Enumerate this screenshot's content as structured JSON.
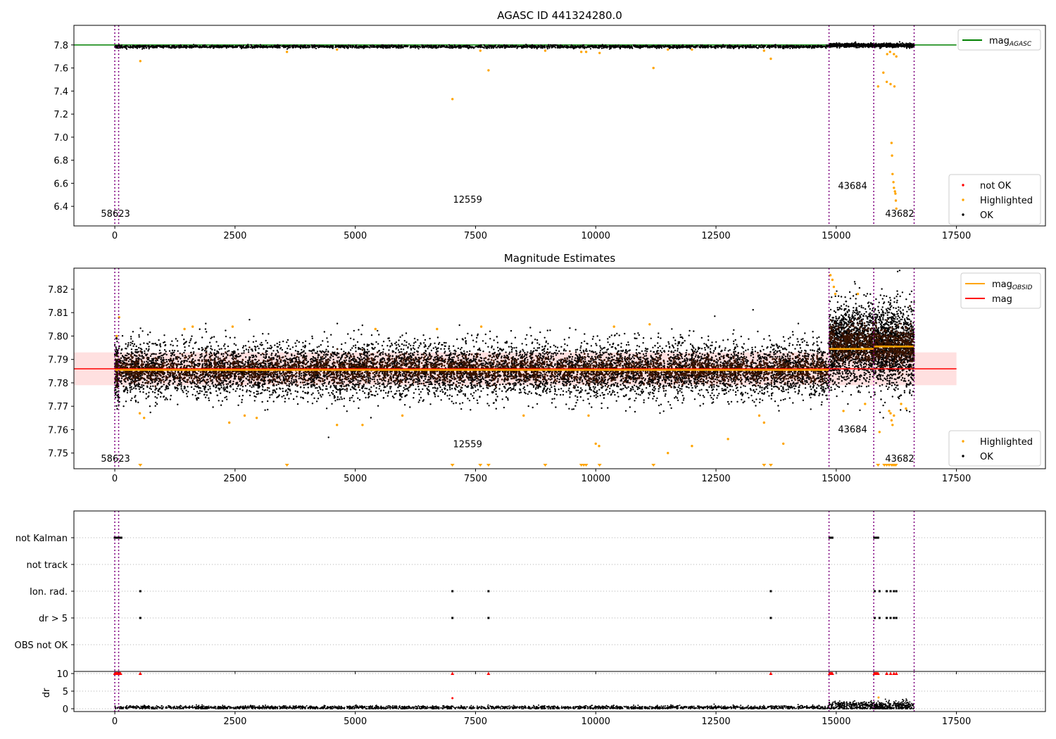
{
  "figure_title": "AGASC ID 441324280.0",
  "chart_data": [
    {
      "id": "top",
      "type": "scatter",
      "title": "AGASC ID 441324280.0",
      "xlim": [
        -850,
        19350
      ],
      "ylim": [
        6.23,
        7.97
      ],
      "xticks": [
        0,
        2500,
        5000,
        7500,
        10000,
        12500,
        15000,
        17500
      ],
      "yticks": [
        6.4,
        6.6,
        6.8,
        7.0,
        7.2,
        7.4,
        7.6,
        7.8
      ],
      "ytick_labels": [
        "6.4",
        "6.6",
        "6.8",
        "7.0",
        "7.2",
        "7.4",
        "7.6",
        "7.8"
      ],
      "grid": false,
      "mag_agasc": 7.8,
      "obs_boundaries": [
        0,
        80,
        14850,
        15780,
        16620
      ],
      "obs_labels": [
        {
          "text": "58623",
          "x": 15,
          "y": 6.31
        },
        {
          "text": "12559",
          "x": 7335,
          "y": 6.43
        },
        {
          "text": "43684",
          "x": 15340,
          "y": 6.55
        },
        {
          "text": "43682",
          "x": 16320,
          "y": 6.31
        }
      ],
      "segments": [
        {
          "x0": 0,
          "x1": 80,
          "center": 7.785,
          "spread": 0.007
        },
        {
          "x0": 80,
          "x1": 14850,
          "center": 7.785,
          "spread": 0.006
        },
        {
          "x0": 14850,
          "x1": 15780,
          "center": 7.797,
          "spread": 0.008
        },
        {
          "x0": 15780,
          "x1": 16620,
          "center": 7.796,
          "spread": 0.008
        }
      ],
      "highlighted": [
        {
          "x": 530,
          "y": 7.66
        },
        {
          "x": 3580,
          "y": 7.74
        },
        {
          "x": 4620,
          "y": 7.76
        },
        {
          "x": 7020,
          "y": 7.33
        },
        {
          "x": 7600,
          "y": 7.75
        },
        {
          "x": 7770,
          "y": 7.58
        },
        {
          "x": 8950,
          "y": 7.75
        },
        {
          "x": 9700,
          "y": 7.74
        },
        {
          "x": 9800,
          "y": 7.74
        },
        {
          "x": 10080,
          "y": 7.73
        },
        {
          "x": 11200,
          "y": 7.6
        },
        {
          "x": 11500,
          "y": 7.76
        },
        {
          "x": 12000,
          "y": 7.76
        },
        {
          "x": 13500,
          "y": 7.75
        },
        {
          "x": 13640,
          "y": 7.68
        },
        {
          "x": 15870,
          "y": 7.44
        },
        {
          "x": 15980,
          "y": 7.56
        },
        {
          "x": 16050,
          "y": 7.48
        },
        {
          "x": 16130,
          "y": 7.46
        },
        {
          "x": 16210,
          "y": 7.44
        },
        {
          "x": 16060,
          "y": 7.72
        },
        {
          "x": 16120,
          "y": 7.74
        },
        {
          "x": 16150,
          "y": 6.95
        },
        {
          "x": 16160,
          "y": 6.84
        },
        {
          "x": 16170,
          "y": 6.68
        },
        {
          "x": 16190,
          "y": 6.61
        },
        {
          "x": 16200,
          "y": 6.56
        },
        {
          "x": 16220,
          "y": 6.53
        },
        {
          "x": 16230,
          "y": 6.51
        },
        {
          "x": 16240,
          "y": 6.45
        },
        {
          "x": 16250,
          "y": 6.38
        },
        {
          "x": 16250,
          "y": 7.7
        },
        {
          "x": 16200,
          "y": 7.72
        }
      ],
      "legend_top": [
        {
          "label": "mag",
          "sub": "AGASC",
          "color": "#008000",
          "kind": "line"
        }
      ],
      "legend_bottom": [
        {
          "label": "not OK",
          "color": "#ff0000",
          "kind": "dot"
        },
        {
          "label": "Highlighted",
          "color": "#ffa500",
          "kind": "dot"
        },
        {
          "label": "OK",
          "color": "#000000",
          "kind": "dot"
        }
      ]
    },
    {
      "id": "mid",
      "type": "scatter",
      "title": "Magnitude Estimates",
      "xlim": [
        -850,
        19350
      ],
      "ylim": [
        7.7433,
        7.829
      ],
      "xticks": [
        0,
        2500,
        5000,
        7500,
        10000,
        12500,
        15000,
        17500
      ],
      "yticks": [
        7.75,
        7.76,
        7.77,
        7.78,
        7.79,
        7.8,
        7.81,
        7.82
      ],
      "ytick_labels": [
        "7.75",
        "7.76",
        "7.77",
        "7.78",
        "7.79",
        "7.80",
        "7.81",
        "7.82"
      ],
      "grid": false,
      "mag": 7.786,
      "mag_band": [
        7.779,
        7.793
      ],
      "mag_obsid": [
        {
          "x0": 0,
          "x1": 80,
          "y": 7.7855
        },
        {
          "x0": 80,
          "x1": 14850,
          "y": 7.7855
        },
        {
          "x0": 14850,
          "x1": 15780,
          "y": 7.7945
        },
        {
          "x0": 15780,
          "x1": 16620,
          "y": 7.7955
        }
      ],
      "obs_boundaries": [
        0,
        80,
        14850,
        15780,
        16620
      ],
      "obs_labels": [
        {
          "text": "58623",
          "x": 15,
          "y": 7.7463
        },
        {
          "text": "12559",
          "x": 7335,
          "y": 7.7525
        },
        {
          "text": "43684",
          "x": 15340,
          "y": 7.7588
        },
        {
          "text": "43682",
          "x": 16320,
          "y": 7.7463
        }
      ],
      "segments": [
        {
          "x0": 0,
          "x1": 80,
          "center": 7.7855,
          "spread": 0.0065
        },
        {
          "x0": 80,
          "x1": 14850,
          "center": 7.7855,
          "spread": 0.006
        },
        {
          "x0": 14850,
          "x1": 15780,
          "center": 7.7965,
          "spread": 0.0085
        },
        {
          "x0": 15780,
          "x1": 16620,
          "center": 7.7955,
          "spread": 0.009
        }
      ],
      "highlighted": [
        {
          "x": 40,
          "y": 7.8
        },
        {
          "x": 90,
          "y": 7.808
        },
        {
          "x": 520,
          "y": 7.767
        },
        {
          "x": 610,
          "y": 7.765
        },
        {
          "x": 1450,
          "y": 7.803
        },
        {
          "x": 1620,
          "y": 7.804
        },
        {
          "x": 2380,
          "y": 7.763
        },
        {
          "x": 2450,
          "y": 7.804
        },
        {
          "x": 2700,
          "y": 7.766
        },
        {
          "x": 2950,
          "y": 7.765
        },
        {
          "x": 4620,
          "y": 7.762
        },
        {
          "x": 5150,
          "y": 7.762
        },
        {
          "x": 5420,
          "y": 7.803
        },
        {
          "x": 5980,
          "y": 7.766
        },
        {
          "x": 6700,
          "y": 7.803
        },
        {
          "x": 7620,
          "y": 7.804
        },
        {
          "x": 8500,
          "y": 7.766
        },
        {
          "x": 9850,
          "y": 7.766
        },
        {
          "x": 10000,
          "y": 7.754
        },
        {
          "x": 10070,
          "y": 7.753
        },
        {
          "x": 10380,
          "y": 7.804
        },
        {
          "x": 11120,
          "y": 7.805
        },
        {
          "x": 11500,
          "y": 7.75
        },
        {
          "x": 12000,
          "y": 7.753
        },
        {
          "x": 12750,
          "y": 7.756
        },
        {
          "x": 13400,
          "y": 7.766
        },
        {
          "x": 13500,
          "y": 7.763
        },
        {
          "x": 13900,
          "y": 7.754
        },
        {
          "x": 14880,
          "y": 7.826
        },
        {
          "x": 14920,
          "y": 7.824
        },
        {
          "x": 14950,
          "y": 7.821
        },
        {
          "x": 14980,
          "y": 7.818
        },
        {
          "x": 15150,
          "y": 7.768
        },
        {
          "x": 15450,
          "y": 7.818
        },
        {
          "x": 15600,
          "y": 7.771
        },
        {
          "x": 15900,
          "y": 7.759
        },
        {
          "x": 16100,
          "y": 7.768
        },
        {
          "x": 16130,
          "y": 7.767
        },
        {
          "x": 16150,
          "y": 7.764
        },
        {
          "x": 16170,
          "y": 7.762
        },
        {
          "x": 16200,
          "y": 7.766
        },
        {
          "x": 16350,
          "y": 7.771
        },
        {
          "x": 16450,
          "y": 7.769
        }
      ],
      "below_limit": [
        530,
        3580,
        7020,
        7600,
        7770,
        8950,
        9700,
        9750,
        9800,
        10080,
        11200,
        13500,
        13640,
        15870,
        16000,
        16050,
        16100,
        16150,
        16180,
        16210,
        16240
      ],
      "legend_top": [
        {
          "label": "mag",
          "sub": "OBSID",
          "color": "#ffa500",
          "kind": "line"
        },
        {
          "label": "mag",
          "sub": "",
          "color": "#ff0000",
          "kind": "line"
        }
      ],
      "legend_bottom": [
        {
          "label": "Highlighted",
          "color": "#ffa500",
          "kind": "dot"
        },
        {
          "label": "OK",
          "color": "#000000",
          "kind": "dot"
        }
      ]
    },
    {
      "id": "flags",
      "type": "scatter",
      "xlim": [
        -850,
        19350
      ],
      "categories": [
        "not Kalman",
        "not track",
        "Ion. rad.",
        "dr > 5",
        "OBS not OK"
      ],
      "grid": true,
      "obs_boundaries": [
        0,
        80,
        14850,
        15780,
        16620
      ],
      "flag_points": [
        {
          "cat": "not Kalman",
          "x": [
            0,
            15,
            30,
            45,
            60,
            75,
            90,
            105,
            120,
            135,
            14860,
            14880,
            14900,
            14920,
            15790,
            15810,
            15830,
            15850,
            15870
          ]
        },
        {
          "cat": "Ion. rad.",
          "x": [
            530,
            7020,
            7770,
            13640,
            15800,
            15900,
            16050,
            16130,
            16200,
            16250
          ]
        },
        {
          "cat": "dr > 5",
          "x": [
            530,
            7020,
            7770,
            13640,
            15800,
            15900,
            16050,
            16130,
            16200,
            16250
          ]
        }
      ]
    },
    {
      "id": "dr",
      "type": "scatter",
      "xlim": [
        -850,
        19350
      ],
      "ylim": [
        -0.8,
        10.6
      ],
      "xticks": [
        0,
        2500,
        5000,
        7500,
        10000,
        12500,
        15000,
        17500
      ],
      "yticks": [
        0,
        5,
        10
      ],
      "ytick_labels": [
        "0",
        "5",
        "10"
      ],
      "ylabel": "dr",
      "grid": true,
      "obs_boundaries": [
        0,
        80,
        14850,
        15780,
        16620
      ],
      "clipped_x": [
        0,
        10,
        20,
        30,
        40,
        50,
        60,
        70,
        80,
        90,
        100,
        110,
        120,
        530,
        7020,
        7770,
        13640,
        14860,
        14875,
        14890,
        14905,
        14920,
        15790,
        15805,
        15820,
        15835,
        15850,
        15870,
        16050,
        16130,
        16200,
        16250
      ],
      "red_points": [
        {
          "x": 7020,
          "y": 3.0
        }
      ],
      "orange_points": [
        {
          "x": 15880,
          "y": 3.2
        }
      ],
      "segments": [
        {
          "x0": 0,
          "x1": 14850,
          "center": 0.35,
          "spread": 0.25
        },
        {
          "x0": 14850,
          "x1": 15780,
          "center": 0.9,
          "spread": 0.6
        },
        {
          "x0": 15780,
          "x1": 16620,
          "center": 0.8,
          "spread": 0.7
        }
      ]
    }
  ]
}
